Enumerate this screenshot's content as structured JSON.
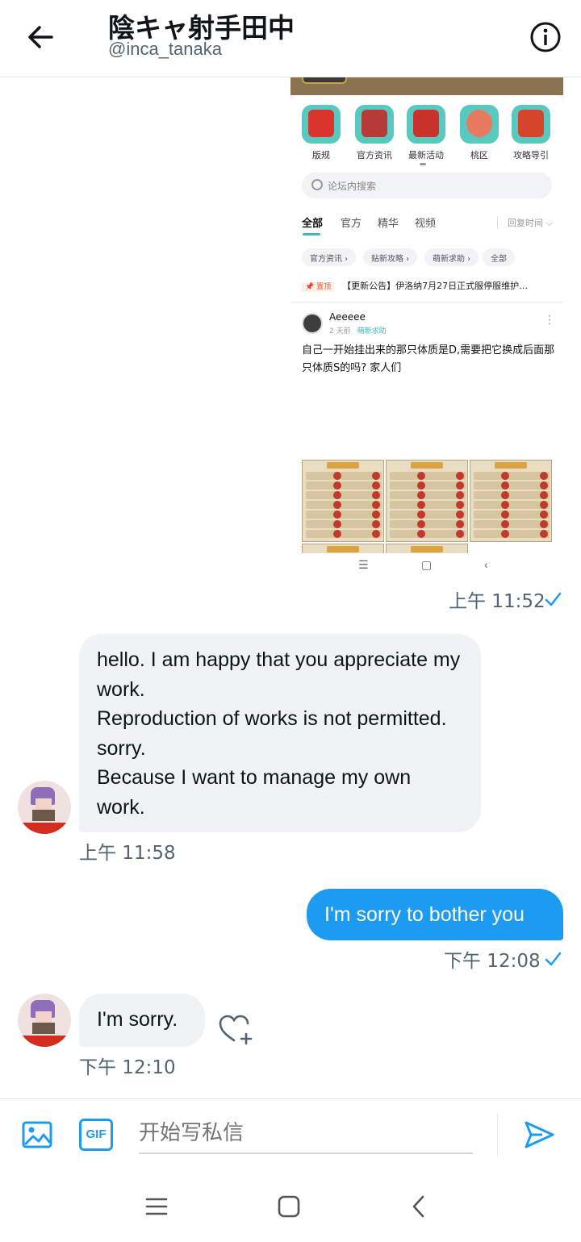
{
  "header": {
    "title": "陰キャ射手田中",
    "handle": "@inca_tanaka"
  },
  "shot": {
    "apps": [
      {
        "label": "版规",
        "color": "#d8342c"
      },
      {
        "label": "官方资讯",
        "color": "#b63a35"
      },
      {
        "label": "最新活动",
        "color": "#c9322a"
      },
      {
        "label": "桃区",
        "color": "#e77a5f"
      },
      {
        "label": "攻略导引",
        "color": "#d4452c"
      }
    ],
    "search_placeholder": "论坛内搜索",
    "tabs": [
      "全部",
      "官方",
      "精华",
      "视频"
    ],
    "sort_label": "回复时间 ⌵",
    "chips": [
      "官方资讯 ›",
      "贴新攻略 ›",
      "萌新求助 ›",
      "全部"
    ],
    "pinned_tag": "📌 置顶",
    "pinned_text": "【更新公告】伊洛纳7月27日正式服停服维护…",
    "post_author": "Aeeeee",
    "post_time": "2 天前",
    "post_category": "萌新求助",
    "post_text": "自己一开始挂出来的那只体质是D,需要把它换成后面那只体质S的吗? 家人们"
  },
  "messages": {
    "ts1": "上午 11:52",
    "in1_lines": [
      "hello. I am happy that you appreciate my work.",
      "Reproduction of works is not permitted. sorry.",
      "Because I want to manage my own work."
    ],
    "ts2": "上午 11:58",
    "out1": "I'm sorry to bother you",
    "ts3": "下午 12:08",
    "in2": "I'm sorry.",
    "ts4": "下午 12:10"
  },
  "composer": {
    "gif_label": "GIF",
    "placeholder": "开始写私信"
  },
  "colors": {
    "accent": "#1d9bf0",
    "bubble_in": "#eff3f4",
    "muted": "#536471"
  }
}
